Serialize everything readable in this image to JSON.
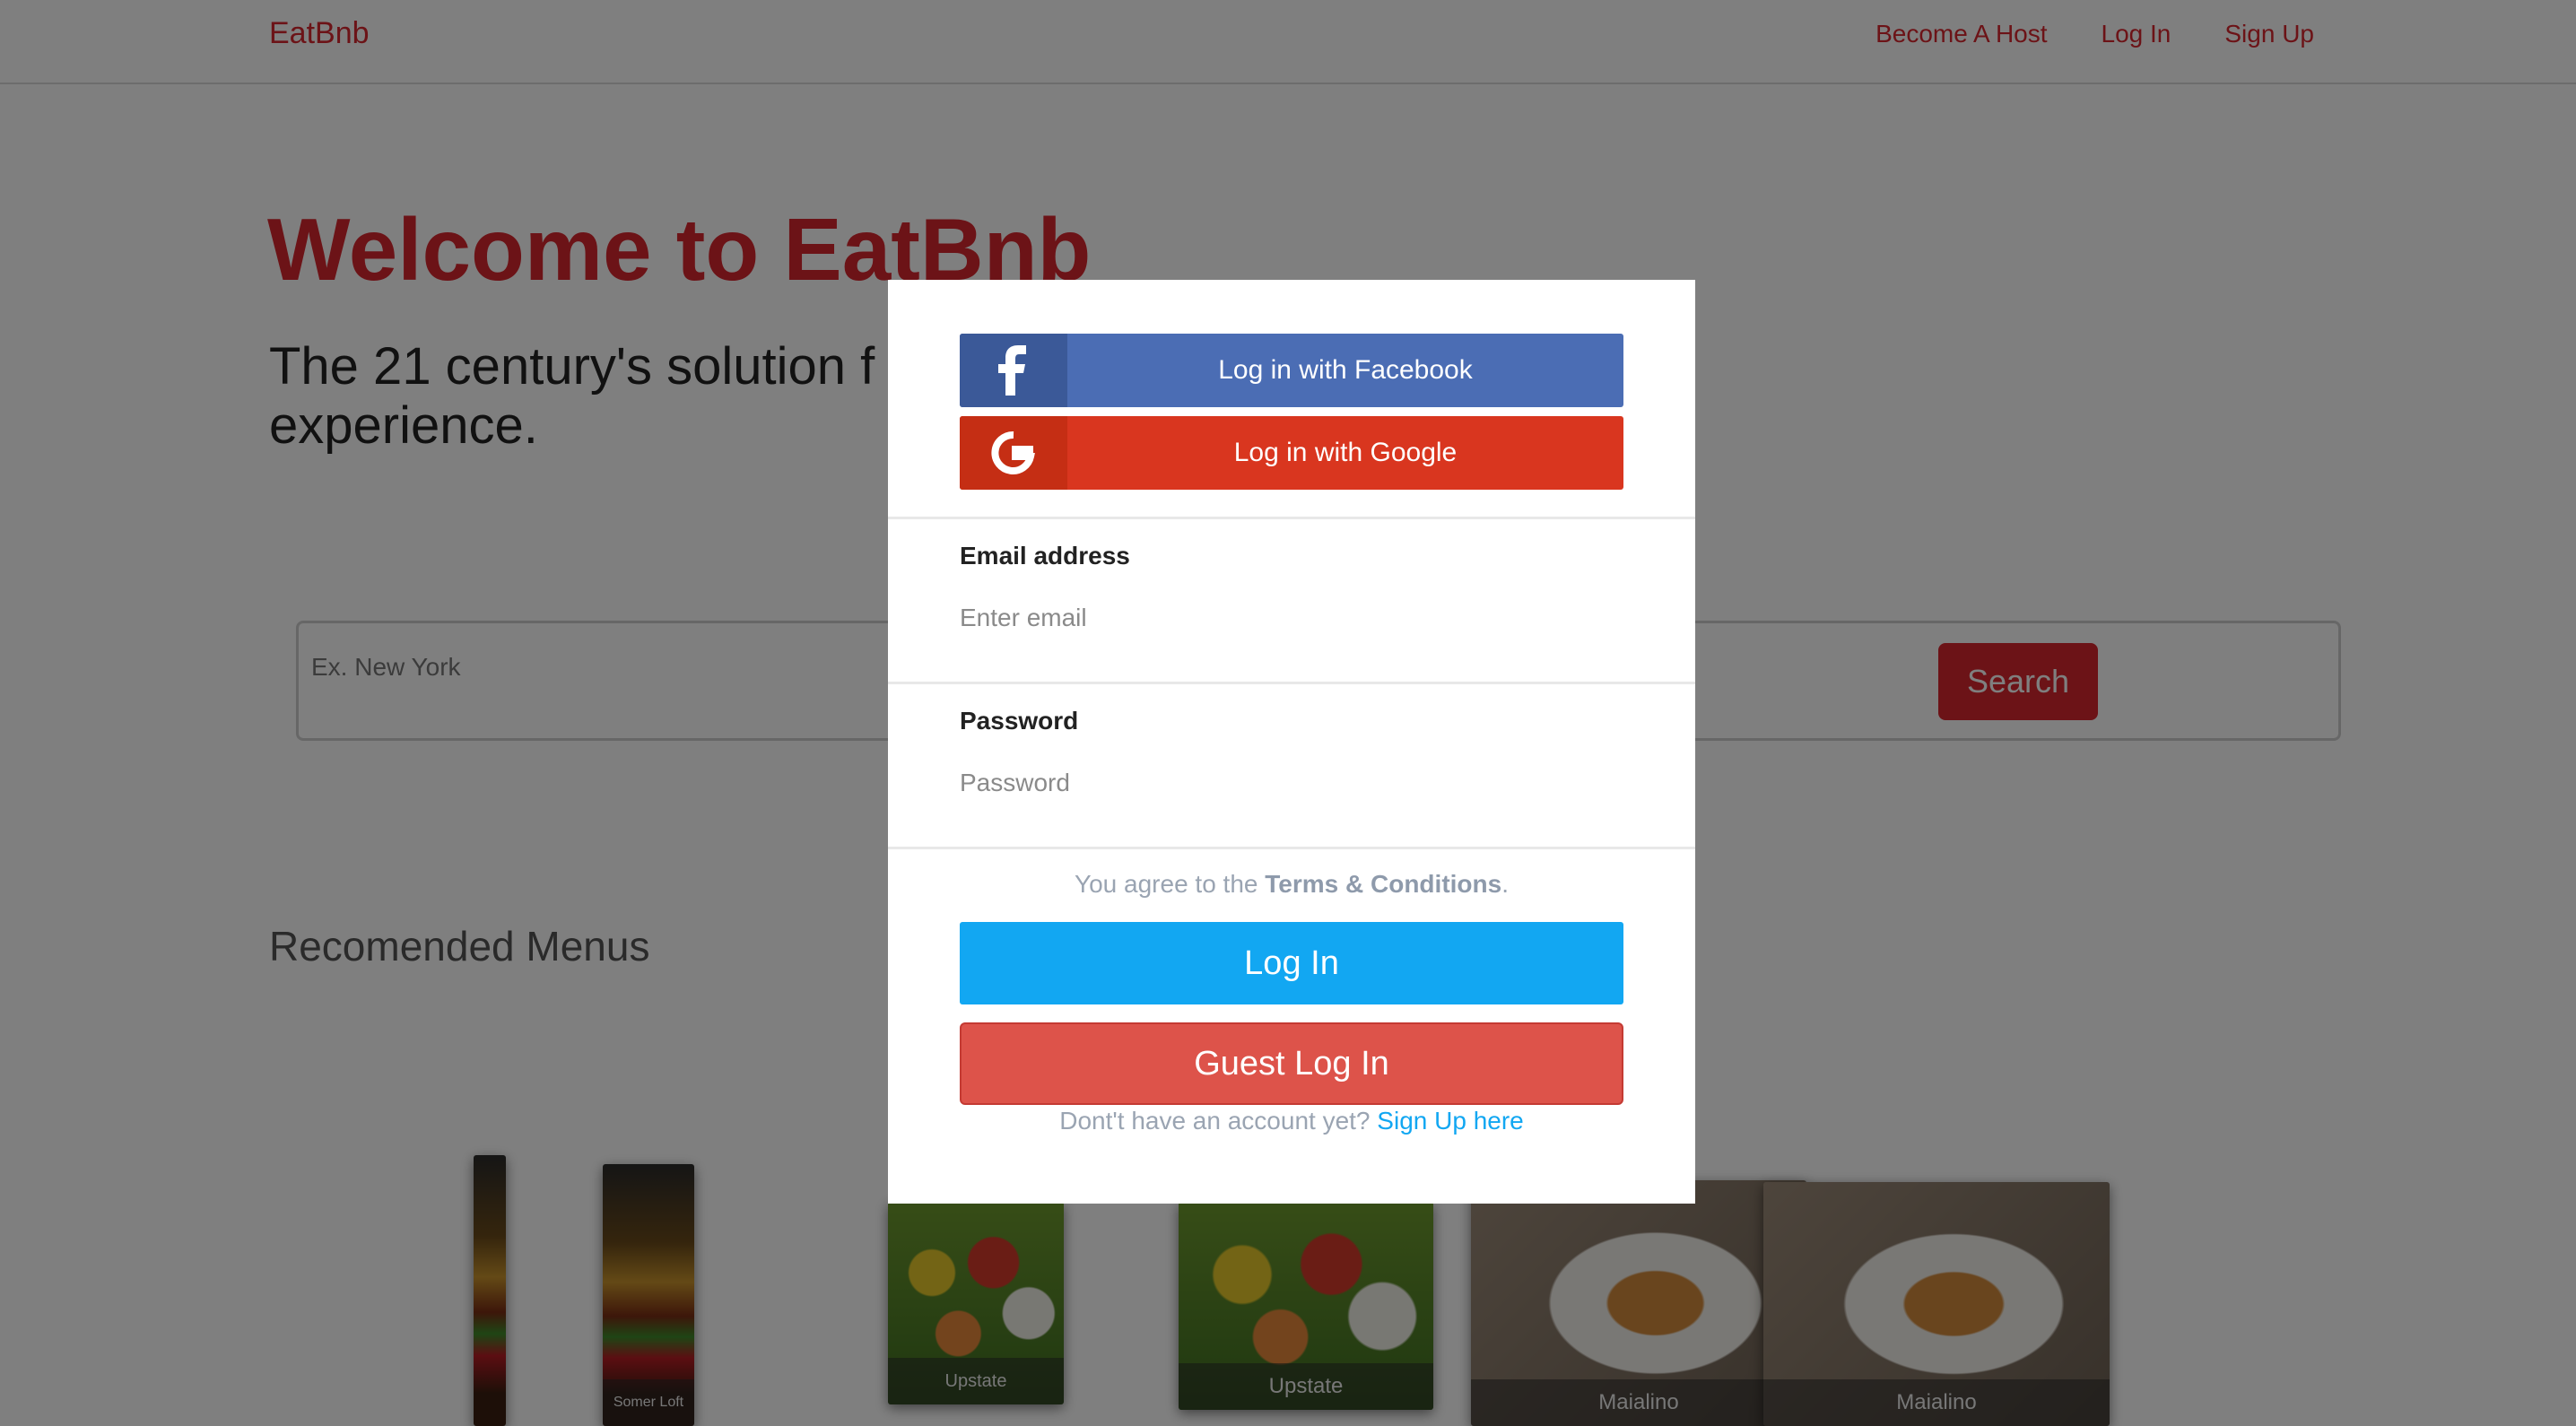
{
  "navbar": {
    "brand": "EatBnb",
    "links": [
      "Become A Host",
      "Log In",
      "Sign Up"
    ]
  },
  "hero": {
    "title": "Welcome to EatBnb",
    "subtitle_line1": "The 21 century's solution f",
    "subtitle_line2": "experience."
  },
  "search": {
    "placeholder": "Ex. New York",
    "button_label": "Search"
  },
  "recommended": {
    "title": "Recomended Menus",
    "cards": [
      {
        "label": "Somer Loft"
      },
      {
        "label": "Upstate"
      },
      {
        "label": "Upstate"
      },
      {
        "label": "Maialino"
      },
      {
        "label": "Maialino"
      }
    ]
  },
  "modal": {
    "facebook_label": "Log in with Facebook",
    "google_label": "Log in with Google",
    "email_label": "Email address",
    "email_placeholder": "Enter email",
    "password_label": "Password",
    "password_placeholder": "Password",
    "terms_prefix": "You agree to the ",
    "terms_link": "Terms & Conditions",
    "terms_suffix": ".",
    "login_label": "Log In",
    "guest_label": "Guest Log In",
    "signup_prefix": "Dont't have an account yet? ",
    "signup_link": "Sign Up here"
  },
  "colors": {
    "brand_red": "#d9272e",
    "facebook": "#4b6db4",
    "google": "#d9361f",
    "login_blue": "#12a7f2",
    "guest_red": "#dd534a"
  },
  "icons": [
    "facebook-icon",
    "google-icon"
  ]
}
